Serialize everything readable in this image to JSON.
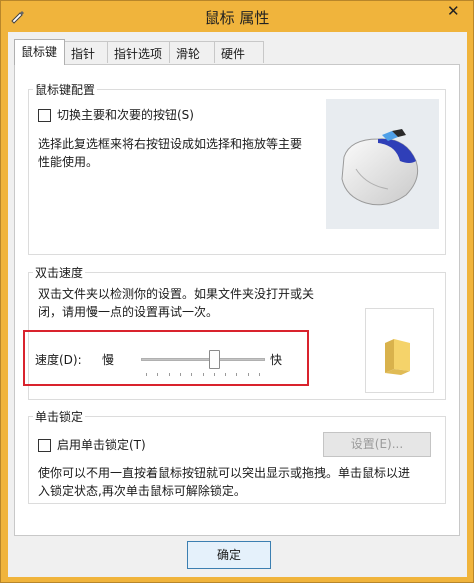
{
  "window": {
    "title": "鼠标 属性",
    "close": "✕"
  },
  "tabs": [
    {
      "label": "鼠标键"
    },
    {
      "label": "指针"
    },
    {
      "label": "指针选项"
    },
    {
      "label": "滑轮"
    },
    {
      "label": "硬件"
    }
  ],
  "button_config": {
    "title": "鼠标键配置",
    "switch_label": "切换主要和次要的按钮(S)",
    "switch_checked": false,
    "description_line1": "选择此复选框来将右按钮设成如选择和拖放等主要",
    "description_line2": "性能使用。"
  },
  "double_click": {
    "title": "双击速度",
    "description_line1": "双击文件夹以检测你的设置。如果文件夹没打开或关",
    "description_line2": "闭，请用慢一点的设置再试一次。",
    "speed_label": "速度(D):",
    "slow": "慢",
    "fast": "快",
    "speed_value": 0.6
  },
  "click_lock": {
    "title": "单击锁定",
    "enable_label": "启用单击锁定(T)",
    "enable_checked": false,
    "settings_button": "设置(E)...",
    "description_line1": "使你可以不用一直按着鼠标按钮就可以突出显示或拖拽。单击鼠标以进",
    "description_line2": "入锁定状态,再次单击鼠标可解除锁定。"
  },
  "footer": {
    "ok_button": "确定"
  },
  "colors": {
    "accent_frame": "#f0b43c",
    "highlight": "#d9232d"
  }
}
